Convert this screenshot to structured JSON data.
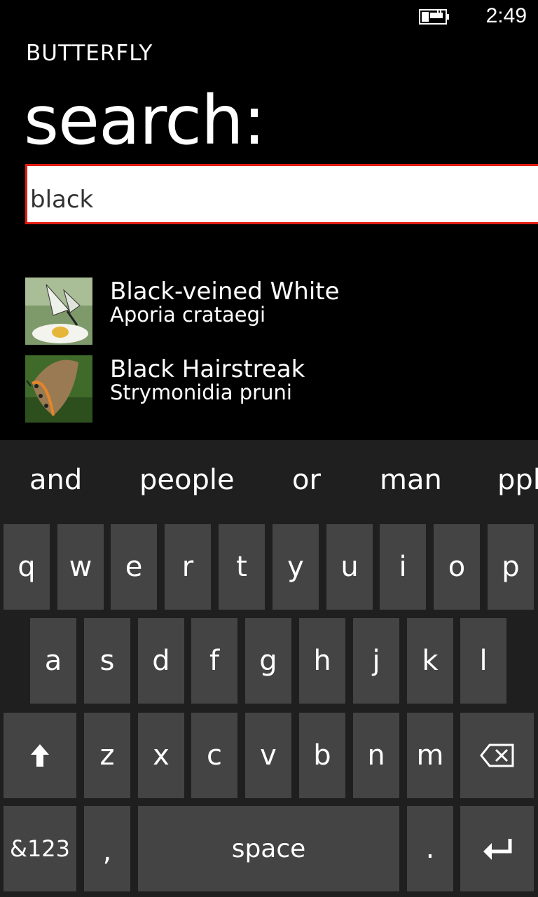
{
  "status": {
    "time": "2:49",
    "battery_icon": "battery-charging-icon"
  },
  "app": {
    "title": "BUTTERFLY",
    "page_title": "search:"
  },
  "search": {
    "value": "black"
  },
  "results": [
    {
      "name": "Black-veined White",
      "scientific": "Aporia crataegi",
      "thumb_icon": "butterfly-white-thumbnail"
    },
    {
      "name": "Black Hairstreak",
      "scientific": "Strymonidia pruni",
      "thumb_icon": "butterfly-brown-thumbnail"
    }
  ],
  "keyboard": {
    "suggestions": [
      "and",
      "people",
      "or",
      "man",
      "ppl"
    ],
    "row1": [
      "q",
      "w",
      "e",
      "r",
      "t",
      "y",
      "u",
      "i",
      "o",
      "p"
    ],
    "row2": [
      "a",
      "s",
      "d",
      "f",
      "g",
      "h",
      "j",
      "k",
      "l"
    ],
    "row3": [
      "z",
      "x",
      "c",
      "v",
      "b",
      "n",
      "m"
    ],
    "shift_icon": "shift-arrow-icon",
    "backspace_icon": "backspace-icon",
    "enter_icon": "enter-icon",
    "symbols_label": "&123",
    "comma_label": ",",
    "space_label": "space",
    "period_label": "."
  },
  "colors": {
    "background": "#000000",
    "accent": "#e31b12",
    "key": "#444444",
    "keyboard_bg": "#1f1f1f"
  }
}
